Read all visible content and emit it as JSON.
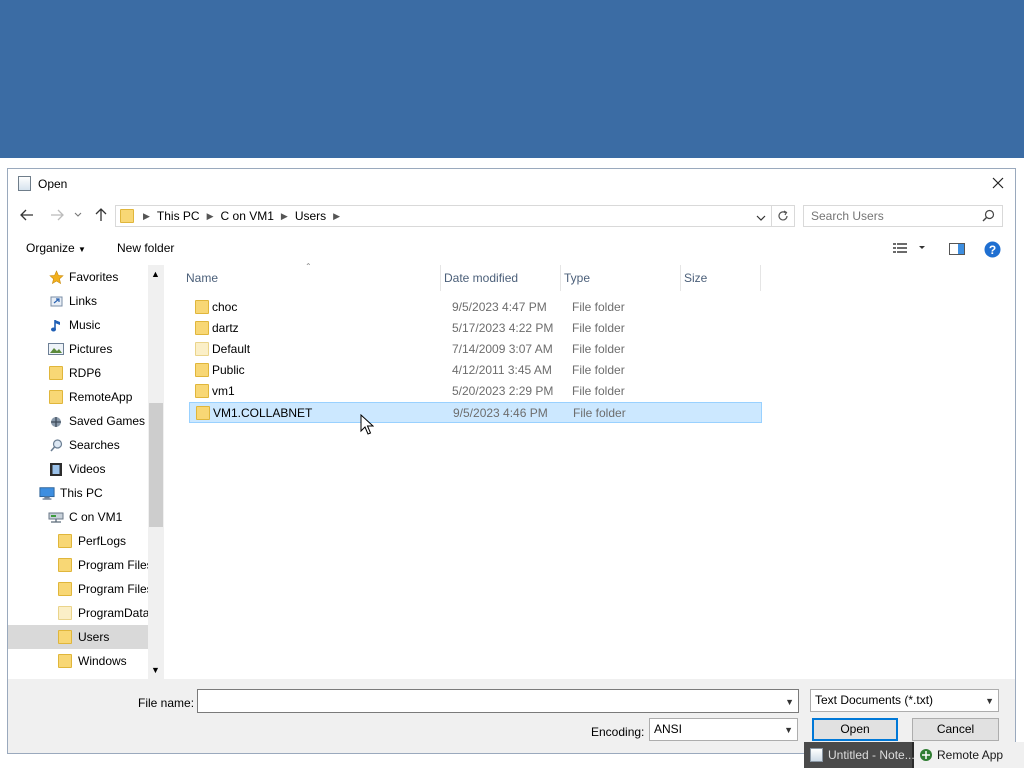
{
  "dialog": {
    "title": "Open",
    "breadcrumb": [
      "This PC",
      "C on VM1",
      "Users"
    ],
    "search_placeholder": "Search Users"
  },
  "toolbar": {
    "organize_label": "Organize",
    "new_folder_label": "New folder"
  },
  "nav": {
    "items": [
      {
        "label": "Favorites",
        "icon": "star-icon"
      },
      {
        "label": "Links",
        "icon": "link-icon"
      },
      {
        "label": "Music",
        "icon": "music-icon"
      },
      {
        "label": "Pictures",
        "icon": "pictures-icon"
      },
      {
        "label": "RDP6",
        "icon": "folder-icon"
      },
      {
        "label": "RemoteApp",
        "icon": "folder-icon"
      },
      {
        "label": "Saved Games",
        "icon": "saved-games-icon"
      },
      {
        "label": "Searches",
        "icon": "search-icon"
      },
      {
        "label": "Videos",
        "icon": "videos-icon"
      },
      {
        "label": "This PC",
        "icon": "computer-icon"
      },
      {
        "label": "C on VM1",
        "icon": "network-drive-icon"
      },
      {
        "label": "PerfLogs",
        "icon": "folder-icon"
      },
      {
        "label": "Program Files",
        "icon": "folder-icon"
      },
      {
        "label": "Program Files",
        "icon": "folder-icon"
      },
      {
        "label": "ProgramData",
        "icon": "folder-icon"
      },
      {
        "label": "Users",
        "icon": "folder-icon"
      },
      {
        "label": "Windows",
        "icon": "folder-icon"
      }
    ]
  },
  "columns": {
    "name": "Name",
    "date": "Date modified",
    "type": "Type",
    "size": "Size"
  },
  "files": [
    {
      "name": "choc",
      "date": "9/5/2023 4:47 PM",
      "type": "File folder"
    },
    {
      "name": "dartz",
      "date": "5/17/2023 4:22 PM",
      "type": "File folder"
    },
    {
      "name": "Default",
      "date": "7/14/2009 3:07 AM",
      "type": "File folder"
    },
    {
      "name": "Public",
      "date": "4/12/2011 3:45 AM",
      "type": "File folder"
    },
    {
      "name": "vm1",
      "date": "5/20/2023 2:29 PM",
      "type": "File folder"
    },
    {
      "name": "VM1.COLLABNET",
      "date": "9/5/2023 4:46 PM",
      "type": "File folder"
    }
  ],
  "bottom": {
    "filename_label": "File name:",
    "filename_value": "",
    "filetype_value": "Text Documents (*.txt)",
    "encoding_label": "Encoding:",
    "encoding_value": "ANSI",
    "open_label": "Open",
    "cancel_label": "Cancel"
  },
  "taskbar": {
    "notepad_label": "Untitled - Note...",
    "remoteapp_label": "Remote App"
  },
  "colors": {
    "desktop": "#3b6ca4",
    "selection": "#cce8ff",
    "accent": "#0078d7",
    "folder": "#f8d775"
  }
}
